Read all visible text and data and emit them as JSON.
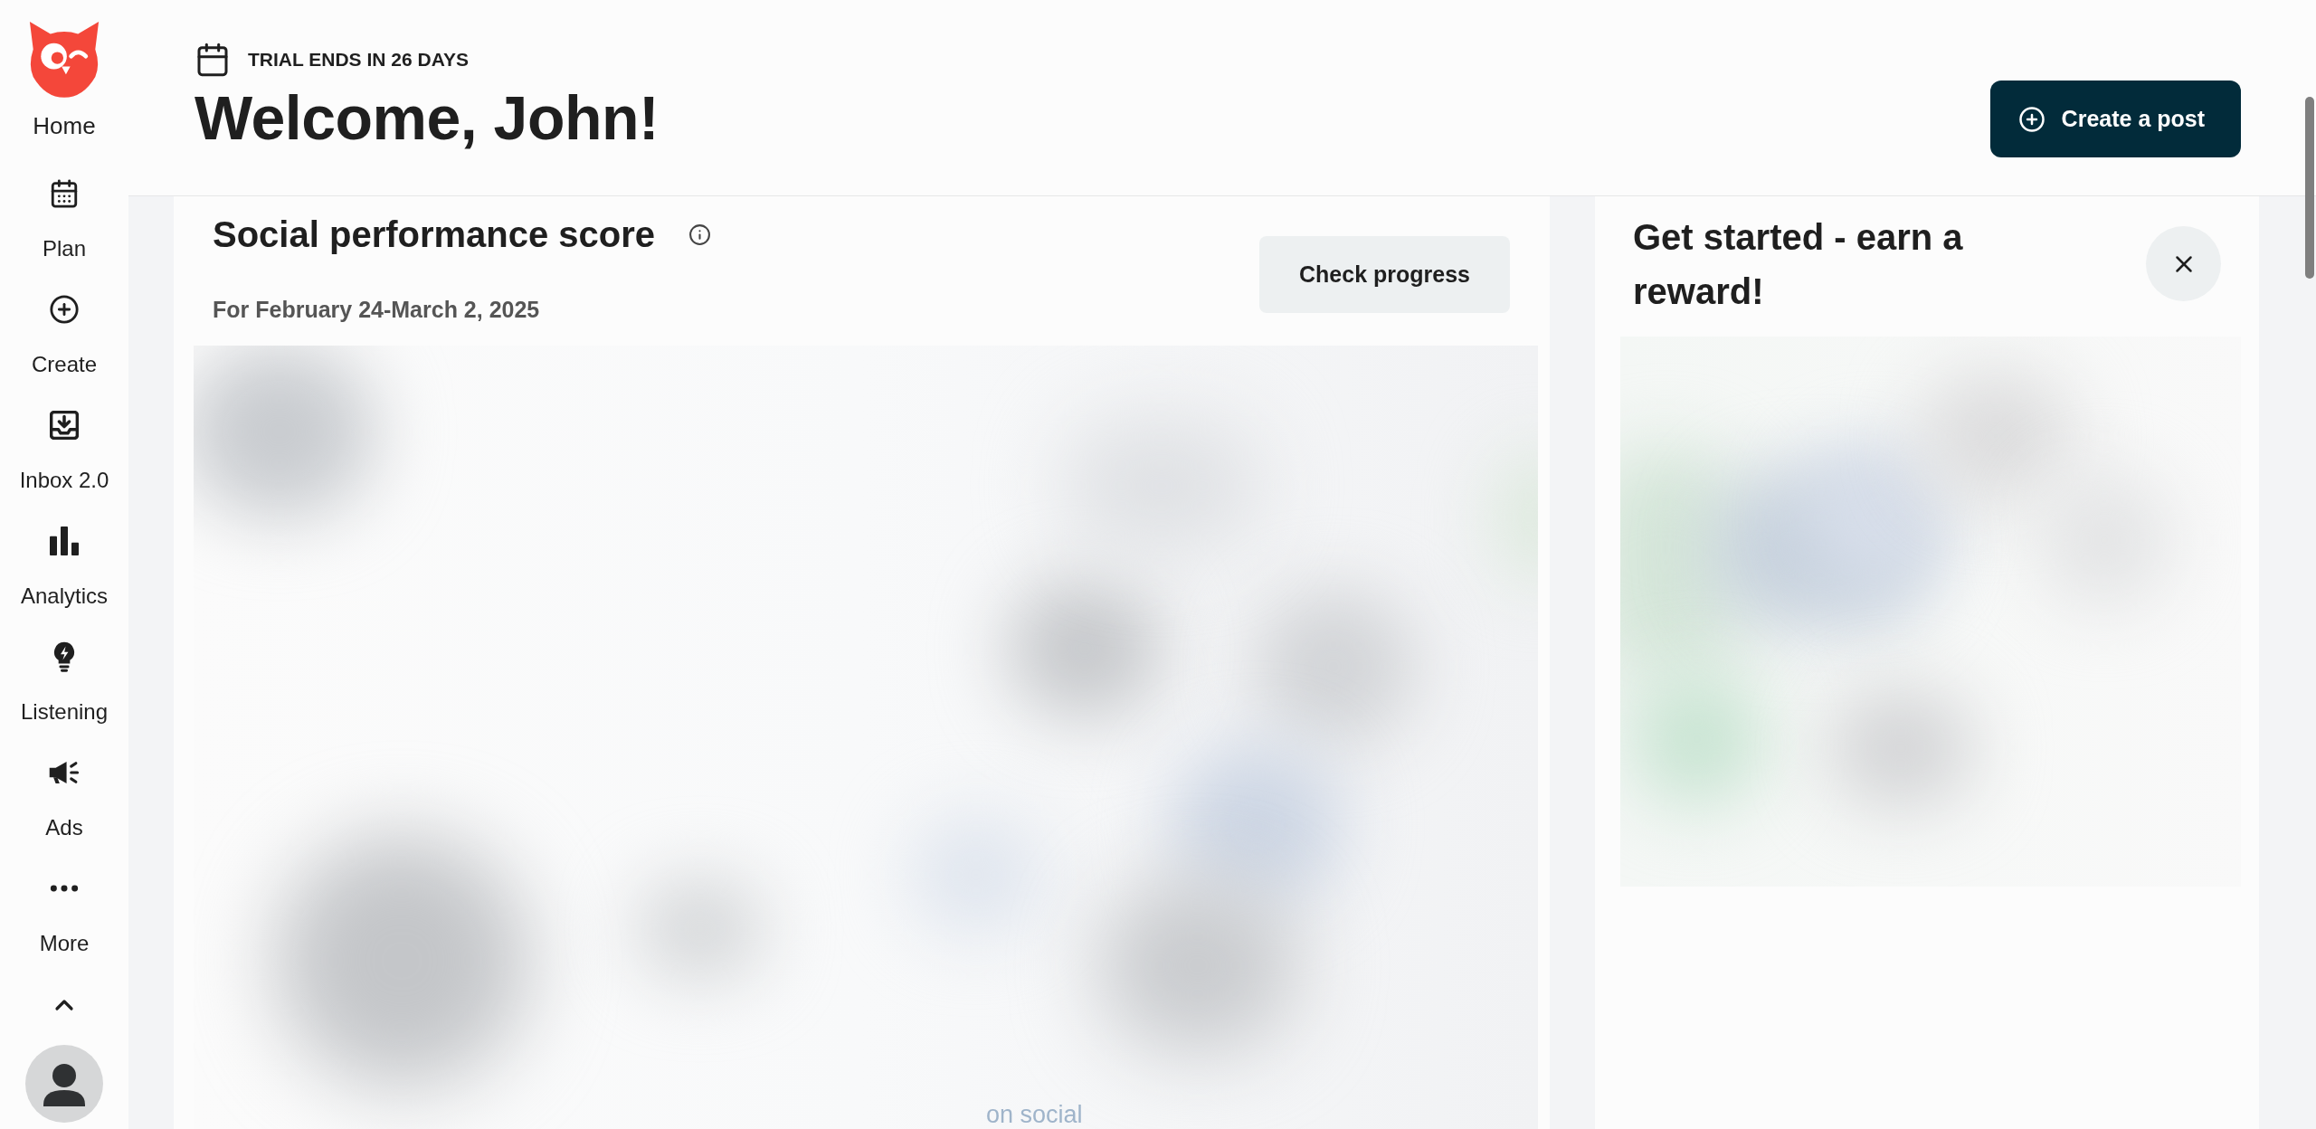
{
  "sidebar": {
    "items": [
      {
        "label": "Home",
        "kind": "brand"
      },
      {
        "label": "Plan",
        "kind": "nav"
      },
      {
        "label": "Create",
        "kind": "nav"
      },
      {
        "label": "Inbox 2.0",
        "kind": "nav"
      },
      {
        "label": "Analytics",
        "kind": "nav"
      },
      {
        "label": "Listening",
        "kind": "nav"
      },
      {
        "label": "Ads",
        "kind": "nav"
      },
      {
        "label": "More",
        "kind": "nav"
      }
    ]
  },
  "header": {
    "trial_notice": "TRIAL ENDS IN 26 DAYS",
    "title": "Welcome, John!",
    "create_button": "Create a post"
  },
  "performance_card": {
    "title": "Social performance score",
    "date_range": "For February 24-March 2, 2025",
    "button": "Check progress",
    "preview_caption": "on social"
  },
  "reward_card": {
    "title": "Get started - earn a reward!"
  }
}
